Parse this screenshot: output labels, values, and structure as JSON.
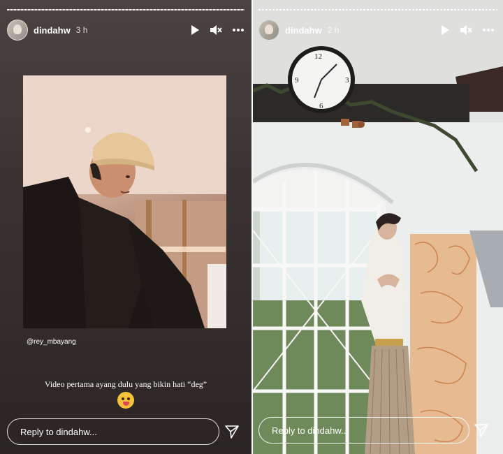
{
  "stories": [
    {
      "username": "dindahw",
      "time": "3 h",
      "credit": "@rey_mbayang",
      "caption": "Video pertama ayang dulu yang bikin hati “deg”",
      "emoji": "zany-face",
      "reply_placeholder": "Reply to dindahw..."
    },
    {
      "username": "dindahw",
      "time": "2 h",
      "reply_placeholder": "Reply to dindahw..."
    }
  ],
  "icons": [
    "play-icon",
    "mute-icon",
    "more-icon",
    "send-icon"
  ]
}
